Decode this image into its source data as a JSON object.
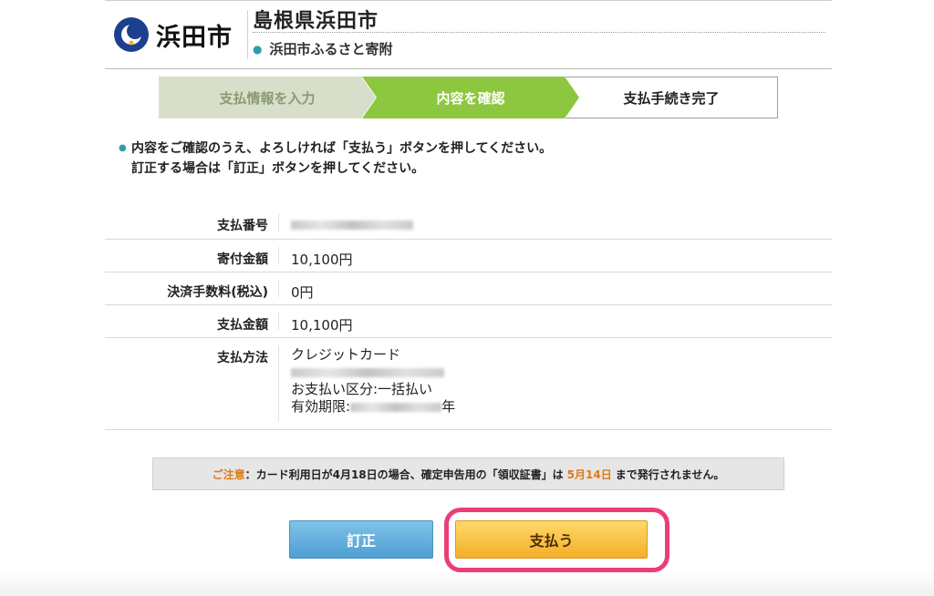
{
  "header": {
    "logo_text": "浜田市",
    "prefecture_title": "島根県浜田市",
    "subtitle": "浜田市ふるさと寄附"
  },
  "steps": [
    {
      "label": "支払情報を入力",
      "state": "done"
    },
    {
      "label": "内容を確認",
      "state": "current"
    },
    {
      "label": "支払手続き完了",
      "state": "pending"
    }
  ],
  "instructions": {
    "line1": "内容をご確認のうえ、よろしければ「支払う」ボタンを押してください。",
    "line2": "訂正する場合は「訂正」ボタンを押してください。"
  },
  "details": {
    "payment_number_label": "支払番号",
    "donation_amount_label": "寄付金額",
    "donation_amount_value": "10,100円",
    "fee_label": "決済手数料(税込)",
    "fee_value": "0円",
    "payment_amount_label": "支払金額",
    "payment_amount_value": "10,100円",
    "payment_method_label": "支払方法",
    "payment_method_value": "クレジットカード",
    "installment_text": "お支払い区分:一括払い",
    "expiry_prefix": "有効期限:",
    "expiry_suffix": "年"
  },
  "notice": {
    "prefix": "ご注意",
    "text_before": "：カード利用日が4月18日の場合、確定申告用の「領収証書」は",
    "date": "5月14日",
    "text_after": "まで発行されません。"
  },
  "buttons": {
    "correct_label": "訂正",
    "pay_label": "支払う"
  },
  "colors": {
    "step_done_bg": "#d7dfca",
    "step_current_bg": "#8dc63f",
    "accent_teal": "#2aa1a6",
    "notice_orange": "#e07b17",
    "highlight_pink": "#ea3e78"
  }
}
